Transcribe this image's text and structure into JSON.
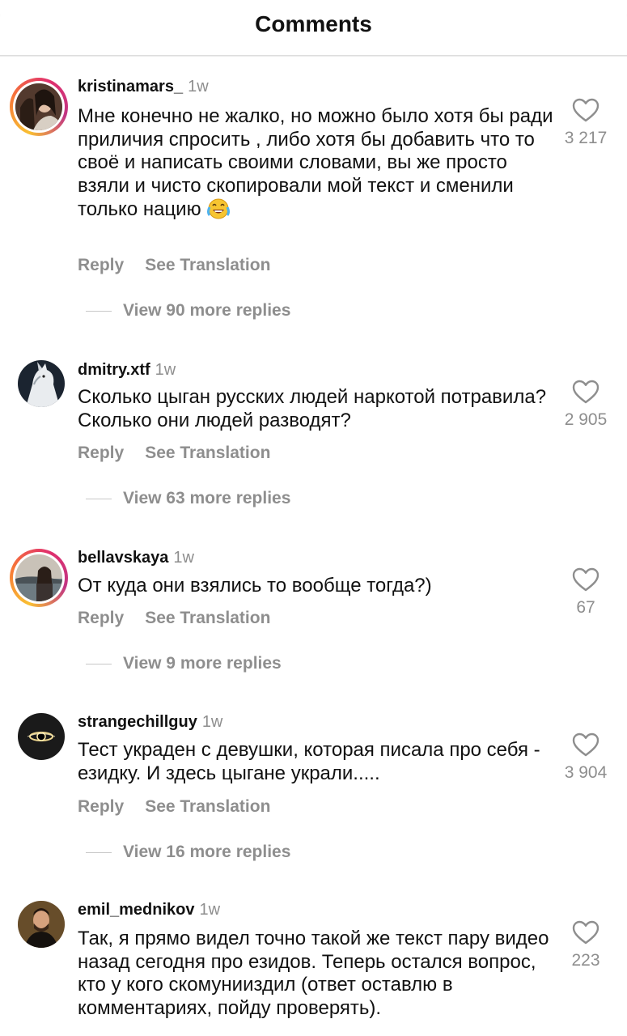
{
  "header": {
    "title": "Comments"
  },
  "labels": {
    "reply": "Reply",
    "see_translation": "See Translation"
  },
  "comments": [
    {
      "username": "kristinamars_",
      "time": "1w",
      "text": "Мне конечно не жалко, но можно было хотя бы ради приличия спросить , либо хотя бы добавить что то своё и написать своими словами, вы же просто взяли и чисто скопировали мой текст и сменили только нацию",
      "has_emoji": true,
      "likes": "3 217",
      "view_replies": "View 90 more replies"
    },
    {
      "username": "dmitry.xtf",
      "time": "1w",
      "text": "Сколько цыган русских людей наркотой потравила? Сколько они людей разводят?",
      "likes": "2 905",
      "view_replies": "View 63 more replies"
    },
    {
      "username": "bellavskaya",
      "time": "1w",
      "text": "От куда они взялись то вообще тогда?)",
      "likes": "67",
      "view_replies": "View 9 more replies"
    },
    {
      "username": "strangechillguy",
      "time": "1w",
      "text": "Тест украден с девушки, которая писала про себя - езидку. И здесь цыгане украли.....",
      "likes": "3 904",
      "view_replies": "View 16 more replies"
    },
    {
      "username": "emil_mednikov",
      "time": "1w",
      "text": "Так, я прямо видел точно такой же текст пару видео назад сегодня про езидов. Теперь остался вопрос, кто у кого скомунииздил (ответ оставлю в комментариях, пойду проверять).",
      "likes": "223"
    }
  ],
  "icons": {
    "like": "heart-outline-icon",
    "emoji": "rolling-on-floor-laughing-emoji"
  },
  "colors": {
    "muted": "#8e8e8e",
    "text": "#111111",
    "story_ring": [
      "#f9c033",
      "#f77737",
      "#e1306c",
      "#c13584"
    ]
  }
}
